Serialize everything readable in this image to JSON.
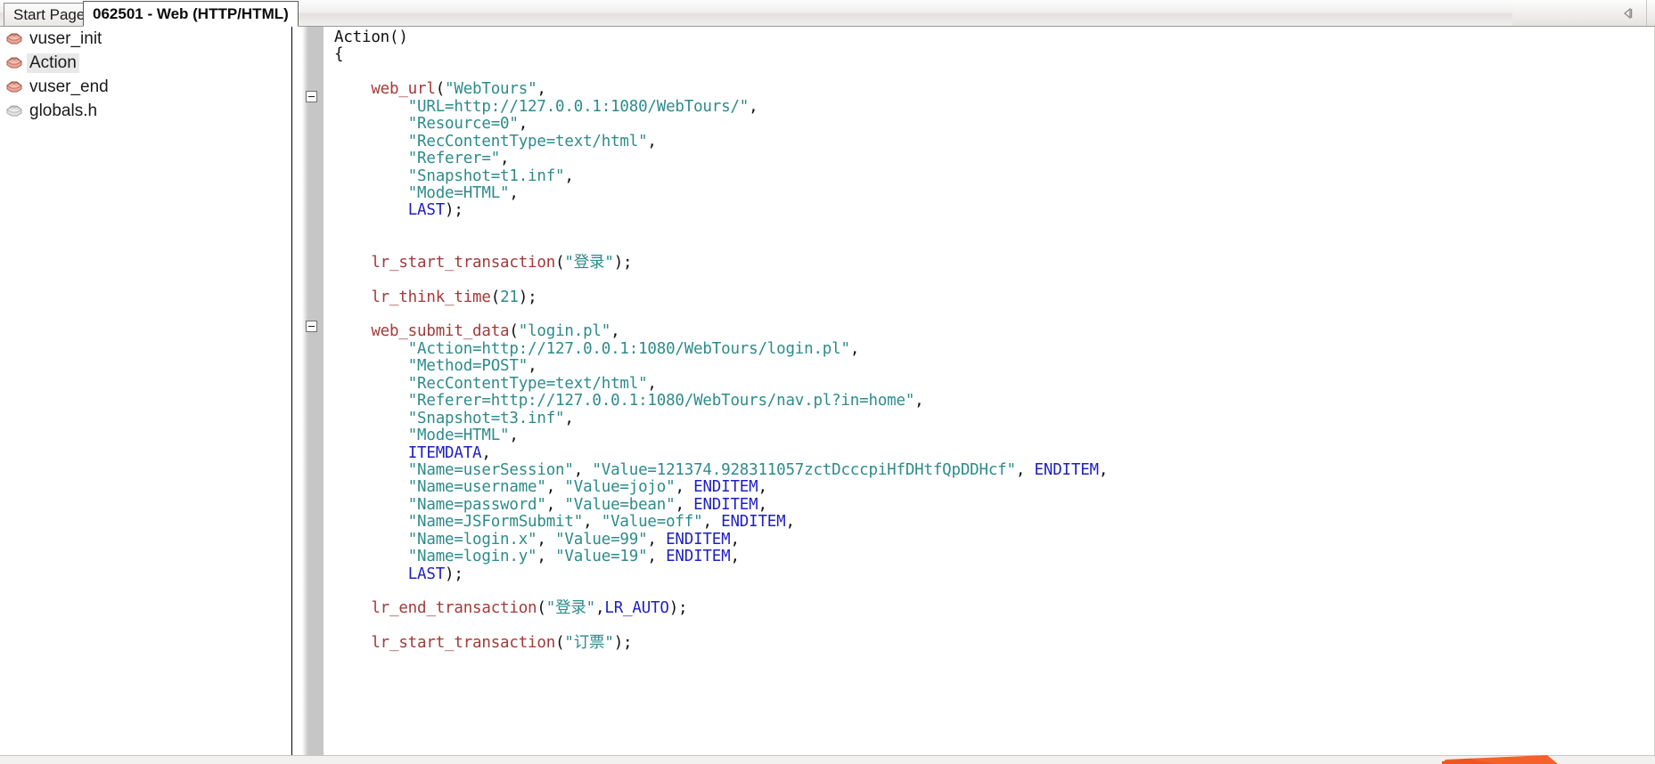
{
  "window": {
    "collapse_arrow_icon": "collapse-left-arrow"
  },
  "tabs": [
    {
      "label": "Start Page",
      "active": false
    },
    {
      "label": "062501 - Web (HTTP/HTML)",
      "active": true
    }
  ],
  "tree": {
    "items": [
      {
        "label": "vuser_init",
        "icon": "action-brick-icon",
        "selected": false
      },
      {
        "label": "Action",
        "icon": "action-brick-icon",
        "selected": true
      },
      {
        "label": "vuser_end",
        "icon": "action-brick-icon",
        "selected": false
      },
      {
        "label": "globals.h",
        "icon": "header-brick-icon",
        "selected": false
      }
    ]
  },
  "editor": {
    "fold_markers": [
      "web_url-fold",
      "web_submit_data-fold"
    ],
    "lines": [
      [
        {
          "t": "Action()",
          "c": "plain"
        }
      ],
      [
        {
          "t": "{",
          "c": "plain"
        }
      ],
      [
        {
          "t": "",
          "c": "plain"
        }
      ],
      [
        {
          "t": "    ",
          "c": "plain"
        },
        {
          "t": "web_url",
          "c": "fn"
        },
        {
          "t": "(",
          "c": "punct"
        },
        {
          "t": "\"WebTours\"",
          "c": "str"
        },
        {
          "t": ",",
          "c": "punct"
        }
      ],
      [
        {
          "t": "        ",
          "c": "plain"
        },
        {
          "t": "\"URL=http://127.0.0.1:1080/WebTours/\"",
          "c": "str"
        },
        {
          "t": ",",
          "c": "punct"
        }
      ],
      [
        {
          "t": "        ",
          "c": "plain"
        },
        {
          "t": "\"Resource=0\"",
          "c": "str"
        },
        {
          "t": ",",
          "c": "punct"
        }
      ],
      [
        {
          "t": "        ",
          "c": "plain"
        },
        {
          "t": "\"RecContentType=text/html\"",
          "c": "str"
        },
        {
          "t": ",",
          "c": "punct"
        }
      ],
      [
        {
          "t": "        ",
          "c": "plain"
        },
        {
          "t": "\"Referer=\"",
          "c": "str"
        },
        {
          "t": ",",
          "c": "punct"
        }
      ],
      [
        {
          "t": "        ",
          "c": "plain"
        },
        {
          "t": "\"Snapshot=t1.inf\"",
          "c": "str"
        },
        {
          "t": ",",
          "c": "punct"
        }
      ],
      [
        {
          "t": "        ",
          "c": "plain"
        },
        {
          "t": "\"Mode=HTML\"",
          "c": "str"
        },
        {
          "t": ",",
          "c": "punct"
        }
      ],
      [
        {
          "t": "        ",
          "c": "plain"
        },
        {
          "t": "LAST",
          "c": "kw"
        },
        {
          "t": ");",
          "c": "punct"
        }
      ],
      [
        {
          "t": "",
          "c": "plain"
        }
      ],
      [
        {
          "t": "",
          "c": "plain"
        }
      ],
      [
        {
          "t": "    ",
          "c": "plain"
        },
        {
          "t": "lr_start_transaction",
          "c": "fn"
        },
        {
          "t": "(",
          "c": "punct"
        },
        {
          "t": "\"登录\"",
          "c": "str"
        },
        {
          "t": ");",
          "c": "punct"
        }
      ],
      [
        {
          "t": "",
          "c": "plain"
        }
      ],
      [
        {
          "t": "    ",
          "c": "plain"
        },
        {
          "t": "lr_think_time",
          "c": "fn"
        },
        {
          "t": "(",
          "c": "punct"
        },
        {
          "t": "21",
          "c": "num"
        },
        {
          "t": ");",
          "c": "punct"
        }
      ],
      [
        {
          "t": "",
          "c": "plain"
        }
      ],
      [
        {
          "t": "    ",
          "c": "plain"
        },
        {
          "t": "web_submit_data",
          "c": "fn"
        },
        {
          "t": "(",
          "c": "punct"
        },
        {
          "t": "\"login.pl\"",
          "c": "str"
        },
        {
          "t": ",",
          "c": "punct"
        }
      ],
      [
        {
          "t": "        ",
          "c": "plain"
        },
        {
          "t": "\"Action=http://127.0.0.1:1080/WebTours/login.pl\"",
          "c": "str"
        },
        {
          "t": ",",
          "c": "punct"
        }
      ],
      [
        {
          "t": "        ",
          "c": "plain"
        },
        {
          "t": "\"Method=POST\"",
          "c": "str"
        },
        {
          "t": ",",
          "c": "punct"
        }
      ],
      [
        {
          "t": "        ",
          "c": "plain"
        },
        {
          "t": "\"RecContentType=text/html\"",
          "c": "str"
        },
        {
          "t": ",",
          "c": "punct"
        }
      ],
      [
        {
          "t": "        ",
          "c": "plain"
        },
        {
          "t": "\"Referer=http://127.0.0.1:1080/WebTours/nav.pl?in=home\"",
          "c": "str"
        },
        {
          "t": ",",
          "c": "punct"
        }
      ],
      [
        {
          "t": "        ",
          "c": "plain"
        },
        {
          "t": "\"Snapshot=t3.inf\"",
          "c": "str"
        },
        {
          "t": ",",
          "c": "punct"
        }
      ],
      [
        {
          "t": "        ",
          "c": "plain"
        },
        {
          "t": "\"Mode=HTML\"",
          "c": "str"
        },
        {
          "t": ",",
          "c": "punct"
        }
      ],
      [
        {
          "t": "        ",
          "c": "plain"
        },
        {
          "t": "ITEMDATA",
          "c": "kw"
        },
        {
          "t": ",",
          "c": "punct"
        }
      ],
      [
        {
          "t": "        ",
          "c": "plain"
        },
        {
          "t": "\"Name=userSession\"",
          "c": "str"
        },
        {
          "t": ", ",
          "c": "punct"
        },
        {
          "t": "\"Value=121374.928311057zctDcccpiHfDHtfQpDDHcf\"",
          "c": "str"
        },
        {
          "t": ", ",
          "c": "punct"
        },
        {
          "t": "ENDITEM",
          "c": "kw"
        },
        {
          "t": ",",
          "c": "punct"
        }
      ],
      [
        {
          "t": "        ",
          "c": "plain"
        },
        {
          "t": "\"Name=username\"",
          "c": "str"
        },
        {
          "t": ", ",
          "c": "punct"
        },
        {
          "t": "\"Value=jojo\"",
          "c": "str"
        },
        {
          "t": ", ",
          "c": "punct"
        },
        {
          "t": "ENDITEM",
          "c": "kw"
        },
        {
          "t": ",",
          "c": "punct"
        }
      ],
      [
        {
          "t": "        ",
          "c": "plain"
        },
        {
          "t": "\"Name=password\"",
          "c": "str"
        },
        {
          "t": ", ",
          "c": "punct"
        },
        {
          "t": "\"Value=bean\"",
          "c": "str"
        },
        {
          "t": ", ",
          "c": "punct"
        },
        {
          "t": "ENDITEM",
          "c": "kw"
        },
        {
          "t": ",",
          "c": "punct"
        }
      ],
      [
        {
          "t": "        ",
          "c": "plain"
        },
        {
          "t": "\"Name=JSFormSubmit\"",
          "c": "str"
        },
        {
          "t": ", ",
          "c": "punct"
        },
        {
          "t": "\"Value=off\"",
          "c": "str"
        },
        {
          "t": ", ",
          "c": "punct"
        },
        {
          "t": "ENDITEM",
          "c": "kw"
        },
        {
          "t": ",",
          "c": "punct"
        }
      ],
      [
        {
          "t": "        ",
          "c": "plain"
        },
        {
          "t": "\"Name=login.x\"",
          "c": "str"
        },
        {
          "t": ", ",
          "c": "punct"
        },
        {
          "t": "\"Value=99\"",
          "c": "str"
        },
        {
          "t": ", ",
          "c": "punct"
        },
        {
          "t": "ENDITEM",
          "c": "kw"
        },
        {
          "t": ",",
          "c": "punct"
        }
      ],
      [
        {
          "t": "        ",
          "c": "plain"
        },
        {
          "t": "\"Name=login.y\"",
          "c": "str"
        },
        {
          "t": ", ",
          "c": "punct"
        },
        {
          "t": "\"Value=19\"",
          "c": "str"
        },
        {
          "t": ", ",
          "c": "punct"
        },
        {
          "t": "ENDITEM",
          "c": "kw"
        },
        {
          "t": ",",
          "c": "punct"
        }
      ],
      [
        {
          "t": "        ",
          "c": "plain"
        },
        {
          "t": "LAST",
          "c": "kw"
        },
        {
          "t": ");",
          "c": "punct"
        }
      ],
      [
        {
          "t": "",
          "c": "plain"
        }
      ],
      [
        {
          "t": "    ",
          "c": "plain"
        },
        {
          "t": "lr_end_transaction",
          "c": "fn"
        },
        {
          "t": "(",
          "c": "punct"
        },
        {
          "t": "\"登录\"",
          "c": "str"
        },
        {
          "t": ",",
          "c": "punct"
        },
        {
          "t": "LR_AUTO",
          "c": "kw"
        },
        {
          "t": ");",
          "c": "punct"
        }
      ],
      [
        {
          "t": "",
          "c": "plain"
        }
      ],
      [
        {
          "t": "    ",
          "c": "plain"
        },
        {
          "t": "lr_start_transaction",
          "c": "fn"
        },
        {
          "t": "(",
          "c": "punct"
        },
        {
          "t": "\"订票\"",
          "c": "str"
        },
        {
          "t": ");",
          "c": "punct"
        }
      ]
    ]
  },
  "colors": {
    "function": "#a33a3a",
    "string": "#2e8b8b",
    "keyword": "#1f1fc4",
    "plain": "#111111",
    "tab_active_bg": "#ffffff",
    "gutter": "#c6c6c6",
    "accent_orange": "#f4622a"
  }
}
